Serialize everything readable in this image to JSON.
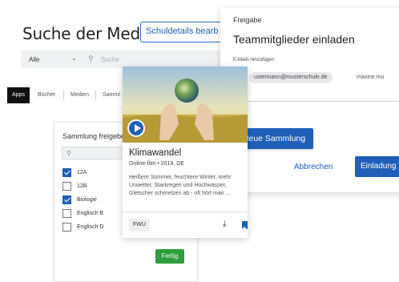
{
  "page": {
    "title": "Suche der Mediath",
    "detail_button": "Schuldetails bearb"
  },
  "search": {
    "filter_value": "Alle",
    "placeholder": "Suche"
  },
  "tabs": [
    {
      "label": "Apps",
      "active": true
    },
    {
      "label": "Bücher",
      "active": false
    },
    {
      "label": "Medien",
      "active": false
    },
    {
      "label": "Samml",
      "active": false
    }
  ],
  "share_panel": {
    "header": "Sammlung freigebe",
    "search_placeholder": "",
    "options": [
      {
        "label": "12A",
        "checked": true
      },
      {
        "label": "12B",
        "checked": false
      },
      {
        "label": "Biologie",
        "checked": true
      },
      {
        "label": "Englisch B",
        "checked": false
      },
      {
        "label": "Englisch D",
        "checked": false
      }
    ],
    "done_button": "Fertig"
  },
  "invite_dialog": {
    "section": "Freigabe",
    "heading": "Teammitglieder einladen",
    "email_label": "E-Mails hinzufügen",
    "email_chips": [
      "ustermann@musterschule.de",
      "maxine.mu"
    ],
    "cancel": "Abbrechen",
    "submit": "Einladung"
  },
  "new_collection_button": "Neue Sammlung",
  "media_card": {
    "title": "Klimawandel",
    "meta": "Online-film • 2019, DE",
    "description": "Heißere Sommer, feuchtere Winter, mehr Unwetter, Starkregen und Hochwasser, Gletscher schmelzen ab - oft hört man ...",
    "publisher": "FWU"
  },
  "icons": {
    "search": "search-icon",
    "chevron": "chevron-down-icon",
    "play": "play-icon",
    "download": "download-icon",
    "bookmark": "bookmark-icon"
  },
  "colors": {
    "primary": "#1f5fb8",
    "success": "#2e9e3c",
    "active_tab": "#111111"
  }
}
